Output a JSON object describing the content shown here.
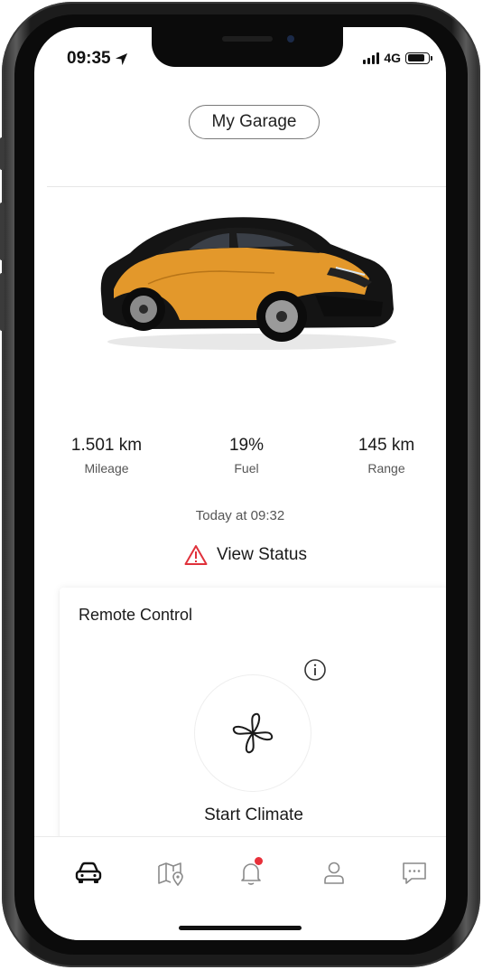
{
  "status_bar": {
    "time": "09:35",
    "network": "4G",
    "battery_level": 0.85
  },
  "header": {
    "garage_button": "My Garage"
  },
  "vehicle": {
    "image": "yellow-black-crossover-car"
  },
  "stats": [
    {
      "value": "1.501 km",
      "label": "Mileage"
    },
    {
      "value": "19%",
      "label": "Fuel"
    },
    {
      "value": "145 km",
      "label": "Range"
    }
  ],
  "updated_text": "Today at 09:32",
  "view_status": {
    "label": "View Status",
    "icon": "warning-triangle-icon",
    "icon_color": "#e0313b"
  },
  "remote_control": {
    "title": "Remote Control",
    "info_icon": "info-icon",
    "action_icon": "fan-icon",
    "action_label": "Start Climate"
  },
  "tab_bar": {
    "items": [
      {
        "name": "car",
        "icon": "car-icon",
        "active": true
      },
      {
        "name": "map",
        "icon": "map-pin-icon",
        "active": false
      },
      {
        "name": "notifications",
        "icon": "bell-icon",
        "active": false,
        "badge_color": "#e8303a"
      },
      {
        "name": "profile",
        "icon": "person-icon",
        "active": false
      },
      {
        "name": "messages",
        "icon": "chat-icon",
        "active": false
      }
    ]
  }
}
